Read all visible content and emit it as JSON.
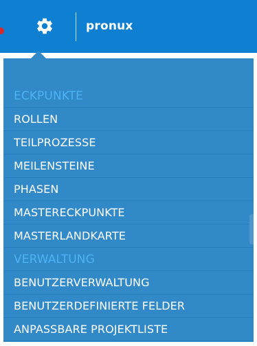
{
  "header": {
    "app_name": "pronux",
    "settings_icon": "gear-icon",
    "background": "#0f7fd2"
  },
  "menu": {
    "background": "#3289c8",
    "section_color": "#4cb3f5",
    "items": [
      {
        "label": "ECKPUNKTE",
        "type": "section"
      },
      {
        "label": "ROLLEN",
        "type": "link"
      },
      {
        "label": "TEILPROZESSE",
        "type": "link"
      },
      {
        "label": "MEILENSTEINE",
        "type": "link"
      },
      {
        "label": "PHASEN",
        "type": "link"
      },
      {
        "label": "MASTERECKPUNKTE",
        "type": "link"
      },
      {
        "label": "MASTERLANDKARTE",
        "type": "link"
      },
      {
        "label": "VERWALTUNG",
        "type": "section"
      },
      {
        "label": "BENUTZERVERWALTUNG",
        "type": "link"
      },
      {
        "label": "BENUTZERDEFINIERTE FELDER",
        "type": "link"
      },
      {
        "label": "ANPASSBARE PROJEKTLISTE",
        "type": "link"
      }
    ]
  }
}
